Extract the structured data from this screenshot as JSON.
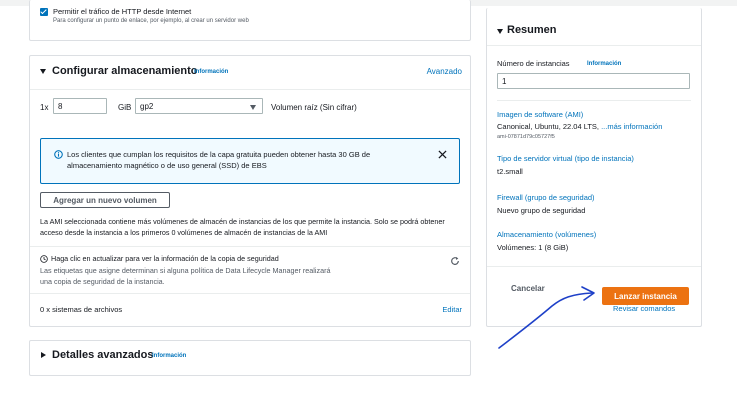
{
  "http": {
    "checkbox_label": "Permitir el tráfico de HTTP desde Internet",
    "checkbox_desc": "Para configurar un punto de enlace, por ejemplo, al crear un servidor web"
  },
  "storage": {
    "title": "Configurar almacenamiento",
    "info": "Información",
    "advanced": "Avanzado",
    "multiplier": "1x",
    "size_value": "8",
    "unit": "GiB",
    "volume_type": "gp2",
    "volume_desc": "Volumen raíz  (Sin cifrar)",
    "alert_text": "Los clientes que cumplan los requisitos de la capa gratuita pueden obtener hasta 30 GB de almacenamiento magnético o de uso general (SSD) de EBS",
    "add_volume": "Agregar un nuevo volumen",
    "ami_note": "La AMI seleccionada contiene más volúmenes de almacén de instancias de los que permite la instancia. Solo se podrá obtener acceso desde la instancia a los primeros 0 volúmenes de almacén de instancias de la AMI",
    "backup_title": "Haga clic en actualizar para ver la información de la copia de seguridad",
    "backup_desc": "Las etiquetas que asigne determinan si alguna política de Data Lifecycle Manager realizará una copia de seguridad de la instancia.",
    "filesystems": "0 x sistemas de archivos",
    "edit": "Editar"
  },
  "advanced": {
    "title": "Detalles avanzados",
    "info": "Información"
  },
  "summary": {
    "title": "Resumen",
    "instances_label": "Número de instancias",
    "instances_info": "Información",
    "instances_value": "1",
    "ami_label": "Imagen de software (AMI)",
    "ami_value": "Canonical, Ubuntu, 22.04 LTS, ",
    "ami_more": "...más información",
    "ami_id": "ami-07871d79c05727f5",
    "type_label": "Tipo de servidor virtual (tipo de instancia)",
    "type_value": "t2.small",
    "firewall_label": "Firewall (grupo de seguridad)",
    "firewall_value": "Nuevo grupo de seguridad",
    "storage_label": "Almacenamiento (volúmenes)",
    "storage_value": "Volúmenes: 1 (8 GiB)",
    "cancel": "Cancelar",
    "launch": "Lanzar instancia",
    "review": "Revisar comandos"
  },
  "colors": {
    "accent": "#0073bb",
    "primary_button": "#ec7211",
    "arrow": "#1e40c8"
  }
}
